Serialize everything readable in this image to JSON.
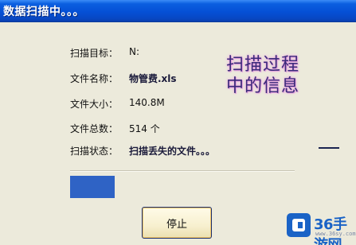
{
  "window": {
    "title": "数据扫描中。。。"
  },
  "fields": [
    {
      "label": "扫描目标：",
      "value": "N:"
    },
    {
      "label": "文件名称：",
      "value": "物管费.xls"
    },
    {
      "label": "文件大小：",
      "value": "140.8M"
    },
    {
      "label": "文件总数：",
      "value": "514 个"
    },
    {
      "label": "扫描状态：",
      "value": "扫描丢失的文件。。。"
    }
  ],
  "annotation": {
    "line1": "扫描过程",
    "line2": "中的信息"
  },
  "progress": {
    "fraction": 0.2
  },
  "buttons": {
    "stop_label": "停止"
  },
  "watermark": {
    "text": "36手游网",
    "sub": "www.36sy.com"
  },
  "colors": {
    "titlebar": "#0550d6",
    "progress_fill": "#2f63c5",
    "background": "#eceadb"
  }
}
